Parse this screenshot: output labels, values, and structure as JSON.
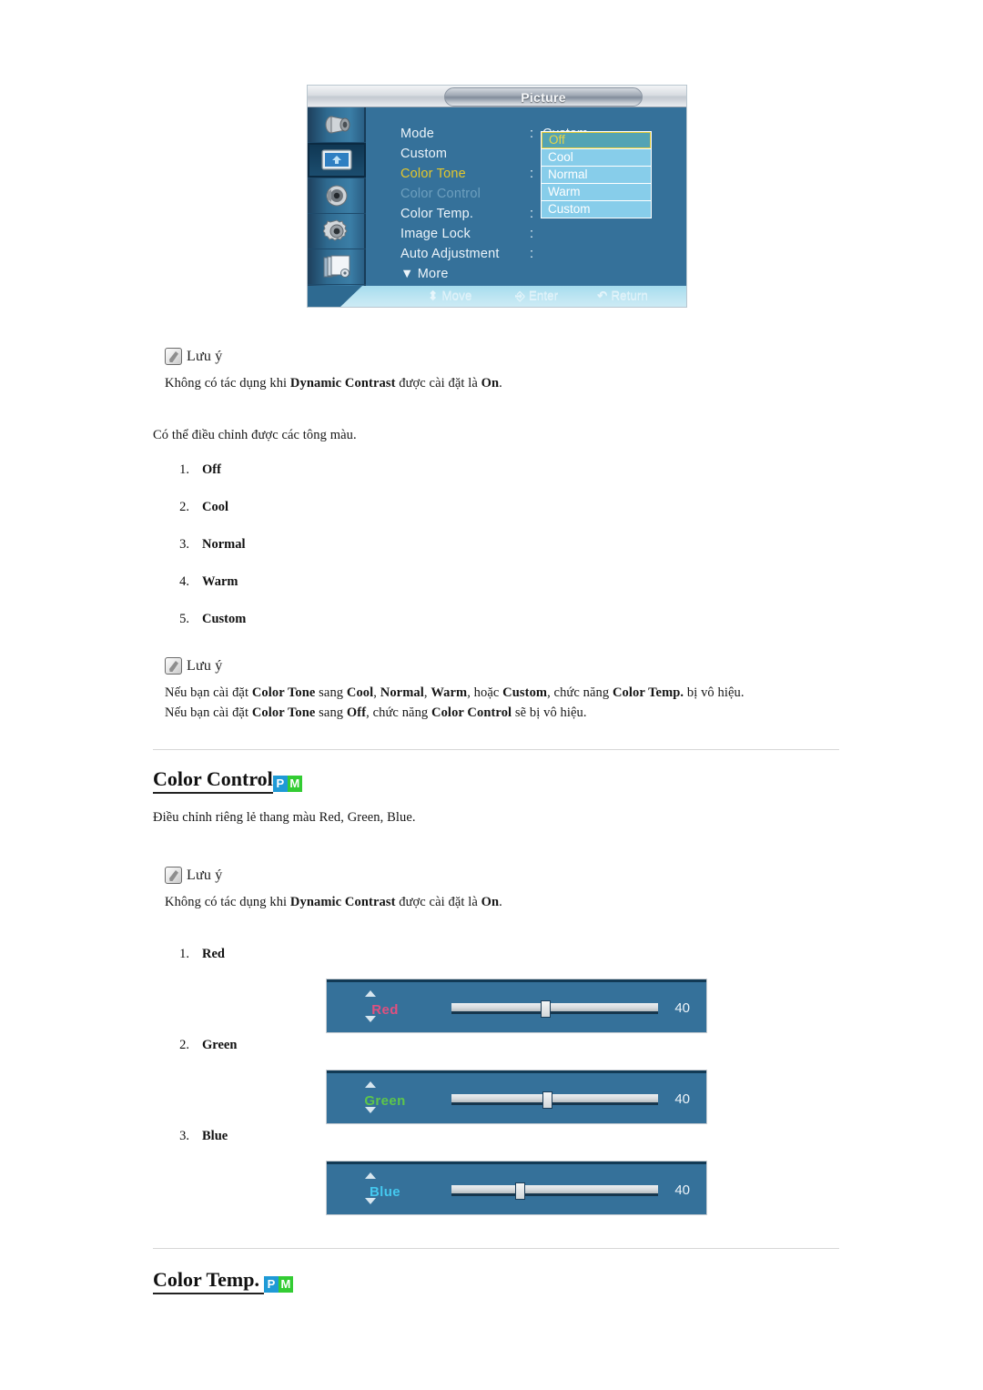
{
  "osd": {
    "title": "Picture",
    "sidebar_icons": [
      {
        "name": "brightness-contrast-icon",
        "active": false
      },
      {
        "name": "picture-icon",
        "active": true
      },
      {
        "name": "sound-speaker-icon",
        "active": false
      },
      {
        "name": "setup-gear-icon",
        "active": false
      },
      {
        "name": "multi-control-icon",
        "active": false
      }
    ],
    "rows": [
      {
        "label": "Mode",
        "colon": ":",
        "value": "Custom",
        "state": "normal"
      },
      {
        "label": "Custom",
        "colon": "",
        "value": "",
        "state": "normal"
      },
      {
        "label": "Color Tone",
        "colon": ":",
        "value": "",
        "state": "highlight"
      },
      {
        "label": "Color Control",
        "colon": "",
        "value": "",
        "state": "disabled"
      },
      {
        "label": "Color Temp.",
        "colon": ":",
        "value": "",
        "state": "normal"
      },
      {
        "label": "Image Lock",
        "colon": ":",
        "value": "",
        "state": "normal"
      },
      {
        "label": "Auto Adjustment",
        "colon": ":",
        "value": "",
        "state": "normal"
      },
      {
        "label": "▼ More",
        "colon": "",
        "value": "",
        "state": "normal"
      }
    ],
    "dropdown": {
      "items": [
        "Off",
        "Cool",
        "Normal",
        "Warm",
        "Custom"
      ],
      "selected": "Off",
      "selected_text_color": "#e9d544",
      "selected_bg_color": "#53a3b4",
      "item_bg_color": "#87cdea"
    },
    "footer": [
      {
        "glyph": "⬍",
        "label": "Move",
        "name": "move-hint"
      },
      {
        "glyph": "↵",
        "label": "Enter",
        "name": "enter-hint"
      },
      {
        "glyph": "↺",
        "label": "Return",
        "name": "return-hint"
      }
    ]
  },
  "note1": {
    "heading": "Lưu ý",
    "line_pre": "Không có tác dụng khi ",
    "line_b1": "Dynamic Contrast",
    "line_mid": " được cài đặt là ",
    "line_b2": "On",
    "line_end": "."
  },
  "intro_paragraph": "Có thể điều chỉnh được các tông màu.",
  "tone_list": [
    {
      "num": "1.",
      "text": "Off"
    },
    {
      "num": "2.",
      "text": "Cool"
    },
    {
      "num": "3.",
      "text": "Normal"
    },
    {
      "num": "4.",
      "text": "Warm"
    },
    {
      "num": "5.",
      "text": "Custom"
    }
  ],
  "note2": {
    "heading": "Lưu ý",
    "l1": {
      "a": "Nếu bạn cài đặt ",
      "b1": "Color Tone",
      "b": " sang ",
      "b2": "Cool",
      "c": ", ",
      "b3": "Normal",
      "d": ", ",
      "b4": "Warm",
      "e": ", hoặc ",
      "b5": "Custom",
      "f": ", chức năng ",
      "b6": "Color Temp.",
      "g": " bị vô hiệu."
    },
    "l2": {
      "a": "Nếu bạn cài đặt ",
      "b1": "Color Tone",
      "b": " sang ",
      "b2": "Off",
      "c": ", chức năng ",
      "b3": "Color Control",
      "d": " sẽ bị vô hiệu."
    }
  },
  "section_color_control": {
    "title": "Color Control",
    "badge_p": "P",
    "badge_m": "M",
    "description": "Điều chỉnh riêng lẻ thang màu Red, Green, Blue."
  },
  "note3": {
    "heading": "Lưu ý",
    "line_pre": "Không có tác dụng khi ",
    "line_b1": "Dynamic Contrast",
    "line_mid": " được cài đặt là ",
    "line_b2": "On",
    "line_end": "."
  },
  "rgb_list": [
    {
      "num": "1.",
      "text": "Red"
    },
    {
      "num": "2.",
      "text": "Green"
    },
    {
      "num": "3.",
      "text": "Blue"
    }
  ],
  "sliders": [
    {
      "label": "Red",
      "value": "40",
      "color": "#e0507f",
      "handle_pct": 45
    },
    {
      "label": "Green",
      "value": "40",
      "color": "#5ec64a",
      "handle_pct": 46
    },
    {
      "label": "Blue",
      "value": "40",
      "color": "#44c8ef",
      "handle_pct": 32
    }
  ],
  "section_color_temp": {
    "title": "Color Temp.",
    "badge_p": "P",
    "badge_m": "M"
  }
}
